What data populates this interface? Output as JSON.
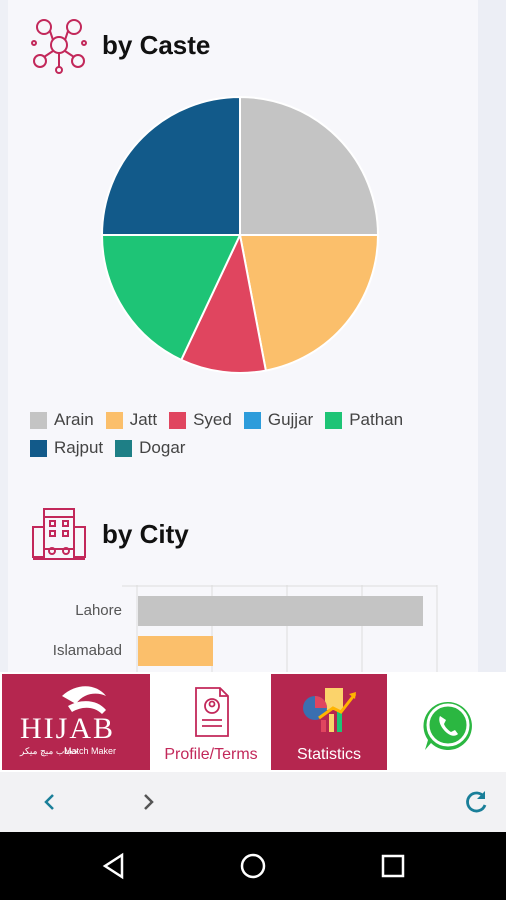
{
  "caste_section": {
    "title": "by Caste",
    "icon": "network-people-icon"
  },
  "chart_data": [
    {
      "type": "pie",
      "title": "",
      "categories": [
        "Arain",
        "Jatt",
        "Syed",
        "Gujjar",
        "Pathan",
        "Rajput",
        "Dogar"
      ],
      "values": [
        25,
        22,
        10,
        0,
        18,
        25,
        0
      ],
      "colors": [
        "#c4c4c4",
        "#fbbf6b",
        "#e0455f",
        "#2d9cdb",
        "#1ec476",
        "#125a8a",
        "#1e7f86"
      ],
      "legend": "bottom-left"
    },
    {
      "type": "bar",
      "orientation": "horizontal",
      "title": "",
      "categories": [
        "Lahore",
        "Islamabad"
      ],
      "values": [
        38,
        10
      ],
      "colors": [
        "#c4c4c4",
        "#fbbf6b"
      ],
      "xlim": [
        0,
        40
      ],
      "grid": true
    }
  ],
  "city_section": {
    "title": "by City",
    "icon": "city-buildings-icon"
  },
  "bottom_nav": {
    "logo_text": "HIJAB",
    "logo_sub": "Match Maker",
    "logo_urdu": "حجاب میچ میکر",
    "profile_label": "Profile/Terms",
    "stats_label": "Statistics",
    "whatsapp_icon": "whatsapp-icon",
    "brand_color": "#b5264f"
  },
  "browser": {
    "back_icon": "chevron-left-icon",
    "forward_icon": "chevron-right-icon",
    "reload_icon": "reload-icon",
    "accent": "#1a7f99"
  },
  "system_nav": {
    "back": "triangle-back-icon",
    "home": "circle-home-icon",
    "recents": "square-recents-icon"
  }
}
